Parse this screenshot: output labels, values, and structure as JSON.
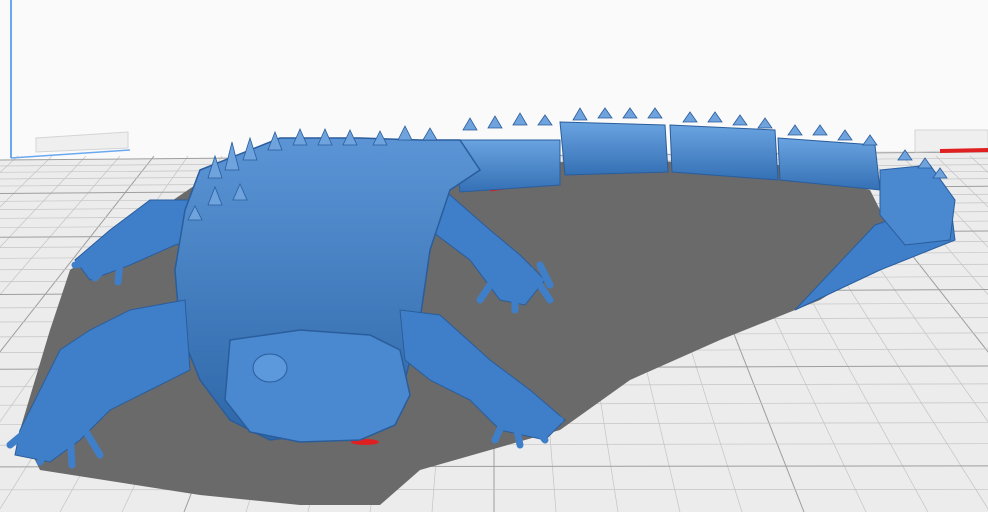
{
  "viewport": {
    "name": "3d-build-plate-viewport",
    "background": "#fafafa",
    "plate_color": "#ececec",
    "grid_minor_color": "#c4c4c4",
    "grid_major_color": "#9e9e9e",
    "shadow_color": "#686868",
    "model_color": "#3f7fc9",
    "model_highlight": "#6fa3dd",
    "model_dark": "#2a5d9c",
    "axis_blue": "#6aa9f0",
    "axis_red": "#e02020"
  },
  "model": {
    "label": "lizard-model"
  }
}
